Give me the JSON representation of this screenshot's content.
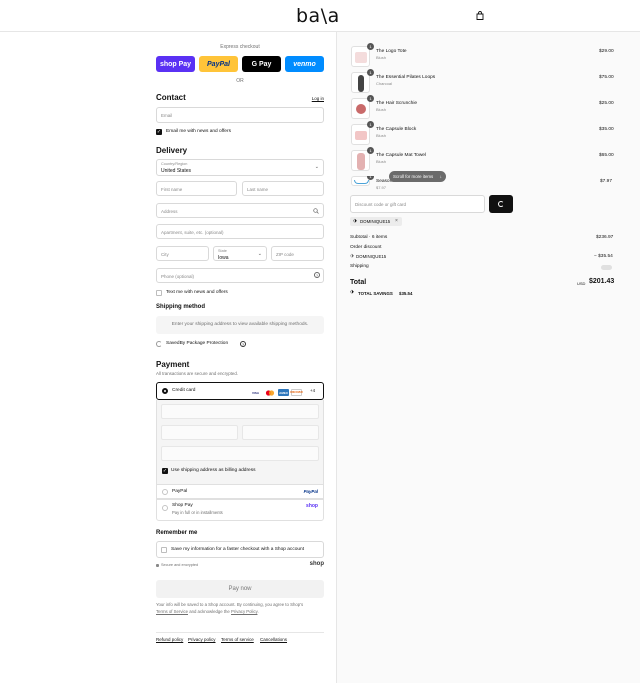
{
  "header": {
    "logo": "ba\\a",
    "bag_icon": "shopping-bag-icon"
  },
  "express": {
    "label": "Express checkout",
    "buttons": [
      {
        "label": "shop Pay",
        "color": "#5a31f4"
      },
      {
        "label": "PayPal",
        "color": "#ffc439"
      },
      {
        "label": "G Pay",
        "color": "#000000"
      },
      {
        "label": "venmo",
        "color": "#008cff"
      }
    ],
    "or": "OR"
  },
  "contact": {
    "title": "Contact",
    "login": "Log in",
    "email_placeholder": "Email",
    "news_label": "Email me with news and offers",
    "news_checked": true
  },
  "delivery": {
    "title": "Delivery",
    "country_label": "Country/Region",
    "country_value": "United States",
    "first_name": "First name",
    "last_name": "Last name",
    "address": "Address",
    "apartment": "Apartment, suite, etc. (optional)",
    "city": "City",
    "state_label": "State",
    "state_value": "Iowa",
    "zip": "ZIP code",
    "phone": "Phone (optional)",
    "text_news": "Text me with news and offers"
  },
  "shipping": {
    "title": "Shipping method",
    "message": "Enter your shipping address to view available shipping methods.",
    "protection": "SavedBy Package Protection"
  },
  "payment": {
    "title": "Payment",
    "subtitle": "All transactions are secure and encrypted.",
    "credit_card": "Credit card",
    "more_cards": "+4",
    "card_icons": [
      "VISA",
      "MC",
      "AMEX",
      "DISCOVER"
    ],
    "billing_label": "Use shipping address as billing address",
    "paypal": "PayPal",
    "paypal_logo": "PayPal",
    "shop_pay": "Shop Pay",
    "shop_pay_sub": "Pay in full or in installments",
    "shop_logo": "shop"
  },
  "remember": {
    "title": "Remember me",
    "label": "Save my information for a faster checkout with a Shop account",
    "secure": "Secure and encrypted",
    "shop": "shop"
  },
  "pay_now": "Pay now",
  "legal": {
    "line1": "Your info will be saved to a Shop account. By continuing, you agree to Shop's",
    "tos": "Terms of Service",
    "line2": " and acknowledge the ",
    "privacy": "Privacy Policy",
    "end": "."
  },
  "footer_links": [
    "Refund policy",
    "Privacy policy",
    "Terms of service",
    "Cancellations"
  ],
  "cart": {
    "items": [
      {
        "qty": "1",
        "name": "The Logo Tote",
        "variant": "Blush",
        "price": "$29.00"
      },
      {
        "qty": "1",
        "name": "The Essential Pilates Loops",
        "variant": "Charcoal",
        "price": "$75.00"
      },
      {
        "qty": "1",
        "name": "The Hair Scrunchie",
        "variant": "Blush",
        "price": "$25.00"
      },
      {
        "qty": "1",
        "name": "The Capsule Block",
        "variant": "Blush",
        "price": "$35.00"
      },
      {
        "qty": "1",
        "name": "The Capsule Mat Towel",
        "variant": "Blush",
        "price": "$65.00"
      },
      {
        "qty": "1",
        "name": "Seasonal...",
        "variant": "$7.97",
        "price": "$7.97"
      }
    ],
    "scroll_hint": "Scroll for more items",
    "discount_placeholder": "Discount code or gift card",
    "applied_code": "DOMINIQUE15",
    "subtotal_label": "Subtotal · 6 items",
    "subtotal_value": "$236.97",
    "order_discount_label": "Order discount",
    "discount_code": "DOMINIQUE15",
    "discount_value": "− $35.54",
    "shipping_label": "Shipping",
    "total_label": "Total",
    "currency": "USD",
    "total_value": "$201.43",
    "savings_label": "TOTAL SAVINGS",
    "savings_value": "$35.54"
  }
}
